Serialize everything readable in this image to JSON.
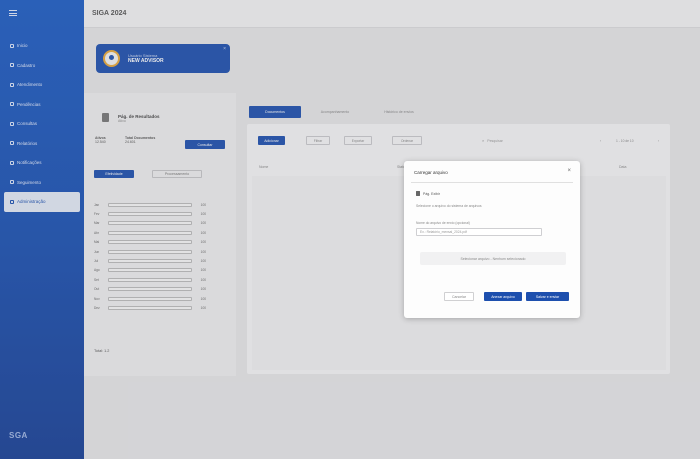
{
  "app": {
    "title": "SIGA 2024",
    "logo": "SGA"
  },
  "sidebar": {
    "items": [
      {
        "label": "Inicio",
        "icon": "home-icon"
      },
      {
        "label": "Cadastro",
        "icon": "folder-icon"
      },
      {
        "label": "Atendimento",
        "icon": "list-icon"
      },
      {
        "label": "Pendências",
        "icon": "clock-icon"
      },
      {
        "label": "Consultas",
        "icon": "search-icon"
      },
      {
        "label": "Relatórios",
        "icon": "chart-icon"
      },
      {
        "label": "Notificações",
        "icon": "bell-icon"
      },
      {
        "label": "Seguimento",
        "icon": "route-icon"
      },
      {
        "label": "Administração",
        "icon": "gear-icon",
        "active": true
      }
    ]
  },
  "profile": {
    "name": "Usuário Sistema",
    "role": "NEW ADVISOR"
  },
  "left_panel": {
    "title": "Pág. de Resultados",
    "subtitle": "Ativo",
    "stats": [
      {
        "key": "Ativos",
        "value": "12.540"
      },
      {
        "key": "Total Documentos",
        "value": "24.601"
      }
    ],
    "action": "Consultar",
    "tabs": [
      "Efetividade",
      "Processamento"
    ],
    "rows": [
      {
        "label": "Jan",
        "value": "100"
      },
      {
        "label": "Fev",
        "value": "100"
      },
      {
        "label": "Mar",
        "value": "100"
      },
      {
        "label": "Abr",
        "value": "100"
      },
      {
        "label": "Mai",
        "value": "100"
      },
      {
        "label": "Jun",
        "value": "100"
      },
      {
        "label": "Jul",
        "value": "100"
      },
      {
        "label": "Ago",
        "value": "100"
      },
      {
        "label": "Set",
        "value": "100"
      },
      {
        "label": "Out",
        "value": "100"
      },
      {
        "label": "Nov",
        "value": "100"
      },
      {
        "label": "Dez",
        "value": "100"
      }
    ],
    "total": "Total: 1.2"
  },
  "main": {
    "tabs": [
      "Documentos",
      "Acompanhamento",
      "Histórico de envios"
    ],
    "toolbar": {
      "primary": "Adicionar",
      "chips": [
        "Filtrar",
        "Exportar",
        "Ordenar"
      ],
      "search_placeholder": "Pesquisar",
      "page": "1 - 10 de 10"
    },
    "columns": [
      "Nome",
      "Status",
      "Data"
    ]
  },
  "modal": {
    "title": "Carregar arquivo",
    "file": "Pág. Exibir",
    "info": "Selecione o arquivo do sistema de arquivos",
    "field_label": "Nome do arquivo de envio (opcional)",
    "field_placeholder": "Ex.: Relatório_mensal_2024.pdf",
    "upload": "Selecionar arquivo - Nenhum selecionado",
    "buttons": {
      "cancel": "Cancelar",
      "secondary": "Anexar arquivo",
      "primary": "Salvar e enviar"
    }
  },
  "colors": {
    "accent": "#1d4fae",
    "sidebar": "#1a4fb0"
  }
}
